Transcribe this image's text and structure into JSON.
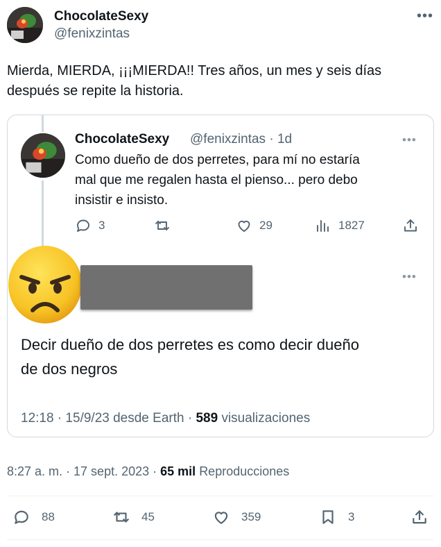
{
  "tweet": {
    "author": {
      "display_name": "ChocolateSexy",
      "handle": "@fenixzintas"
    },
    "more_icon": "more-horizontal-icon",
    "text_line1": "Mierda, MIERDA, ¡¡¡MIERDA!! Tres años, un mes y seis días",
    "text_line2": "después se repite la historia.",
    "timestamp": "8:27 a. m. · 17 sept. 2023 ·",
    "views_count": "65 mil",
    "views_label": "Reproducciones",
    "actions": {
      "reply": "88",
      "retweet": "45",
      "like": "359",
      "bookmark": "3"
    }
  },
  "quote": {
    "parent": {
      "display_name": "ChocolateSexy",
      "handle_time": "@fenixzintas · 1d",
      "text_line1": "Como dueño de dos perretes, para mí no estaría",
      "text_line2": "mal que me regalen hasta el pienso... pero debo",
      "text_line3": "insistir e insisto.",
      "actions": {
        "reply": "3",
        "like": "29",
        "views": "1827"
      }
    },
    "reply": {
      "emoji": "angry-face-icon",
      "text_line1": "Decir dueño de dos perretes es como decir dueño",
      "text_line2": "de dos negros",
      "timestamp": "12:18 · 15/9/23 desde Earth ·",
      "views_count": "589",
      "views_label": "visualizaciones"
    }
  },
  "colors": {
    "text": "#0f1419",
    "secondary": "#536471",
    "border": "#cfd9de",
    "redaction": "#707070",
    "emoji_yellow": "#f7c325"
  }
}
